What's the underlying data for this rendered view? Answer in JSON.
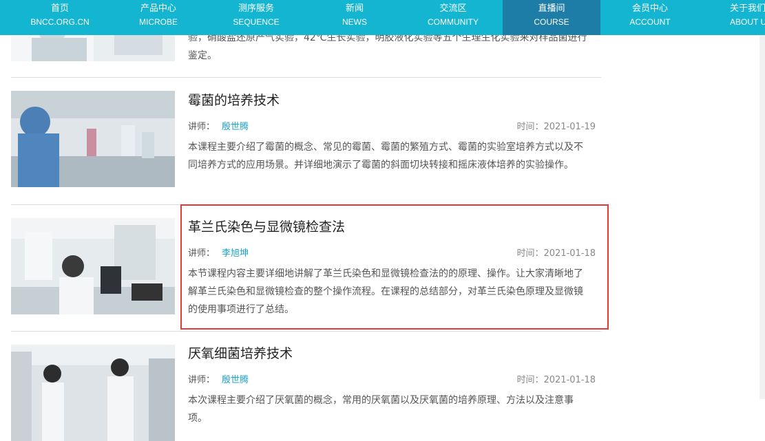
{
  "nav": [
    {
      "cn": "首页",
      "en": "BNCC.ORG.CN"
    },
    {
      "cn": "产品中心",
      "en": "MICROBE"
    },
    {
      "cn": "测序服务",
      "en": "SEQUENCE"
    },
    {
      "cn": "新闻",
      "en": "NEWS"
    },
    {
      "cn": "交流区",
      "en": "COMMUNITY"
    },
    {
      "cn": "直播间",
      "en": "COURSE"
    },
    {
      "cn": "会员中心",
      "en": "ACCOUNT"
    },
    {
      "cn": "关于我们",
      "en": "ABOUT US"
    }
  ],
  "courses": [
    {
      "title": "",
      "teacher_label": "",
      "teacher": "",
      "time": "",
      "desc": "本课程主要介绍了细菌生理生化鉴定方法，并详细介绍了念，并通过氧化酶实验，绿脓菌素实验，硝酸盐还原产气实验，42℃生长实验，明胶液化实验等五个生理生化实验来对样品菌进行鉴定。"
    },
    {
      "title": "霉菌的培养技术",
      "teacher_label": "讲师：",
      "teacher": "殷世腾",
      "time": "时间：2021-01-19",
      "desc": "本课程主要介绍了霉菌的概念、常见的霉菌、霉菌的繁殖方式、霉菌的实验室培养方式以及不同培养方式的应用场景。并详细地演示了霉菌的斜面切块转接和摇床液体培养的实验操作。"
    },
    {
      "title": "革兰氏染色与显微镜检查法",
      "teacher_label": "讲师：",
      "teacher": "李旭坤",
      "time": "时间：2021-01-18",
      "desc": "本节课程内容主要详细地讲解了革兰氏染色和显微镜检查法的的原理、操作。让大家清晰地了解革兰氏染色和显微镜检查的整个操作流程。在课程的总结部分，对革兰氏染色原理及显微镜的使用事项进行了总结。"
    },
    {
      "title": "厌氧细菌培养技术",
      "teacher_label": "讲师：",
      "teacher": "殷世腾",
      "time": "时间：2021-01-18",
      "desc": "本次课程主要介绍了厌氧菌的概念，常用的厌氧菌以及厌氧菌的培养原理、方法以及注意事项。"
    }
  ],
  "colors": {
    "nav_bg": "#13b5d1",
    "nav_active": "#1e7da6",
    "highlight": "#e53935",
    "link": "#1aa3c9"
  }
}
